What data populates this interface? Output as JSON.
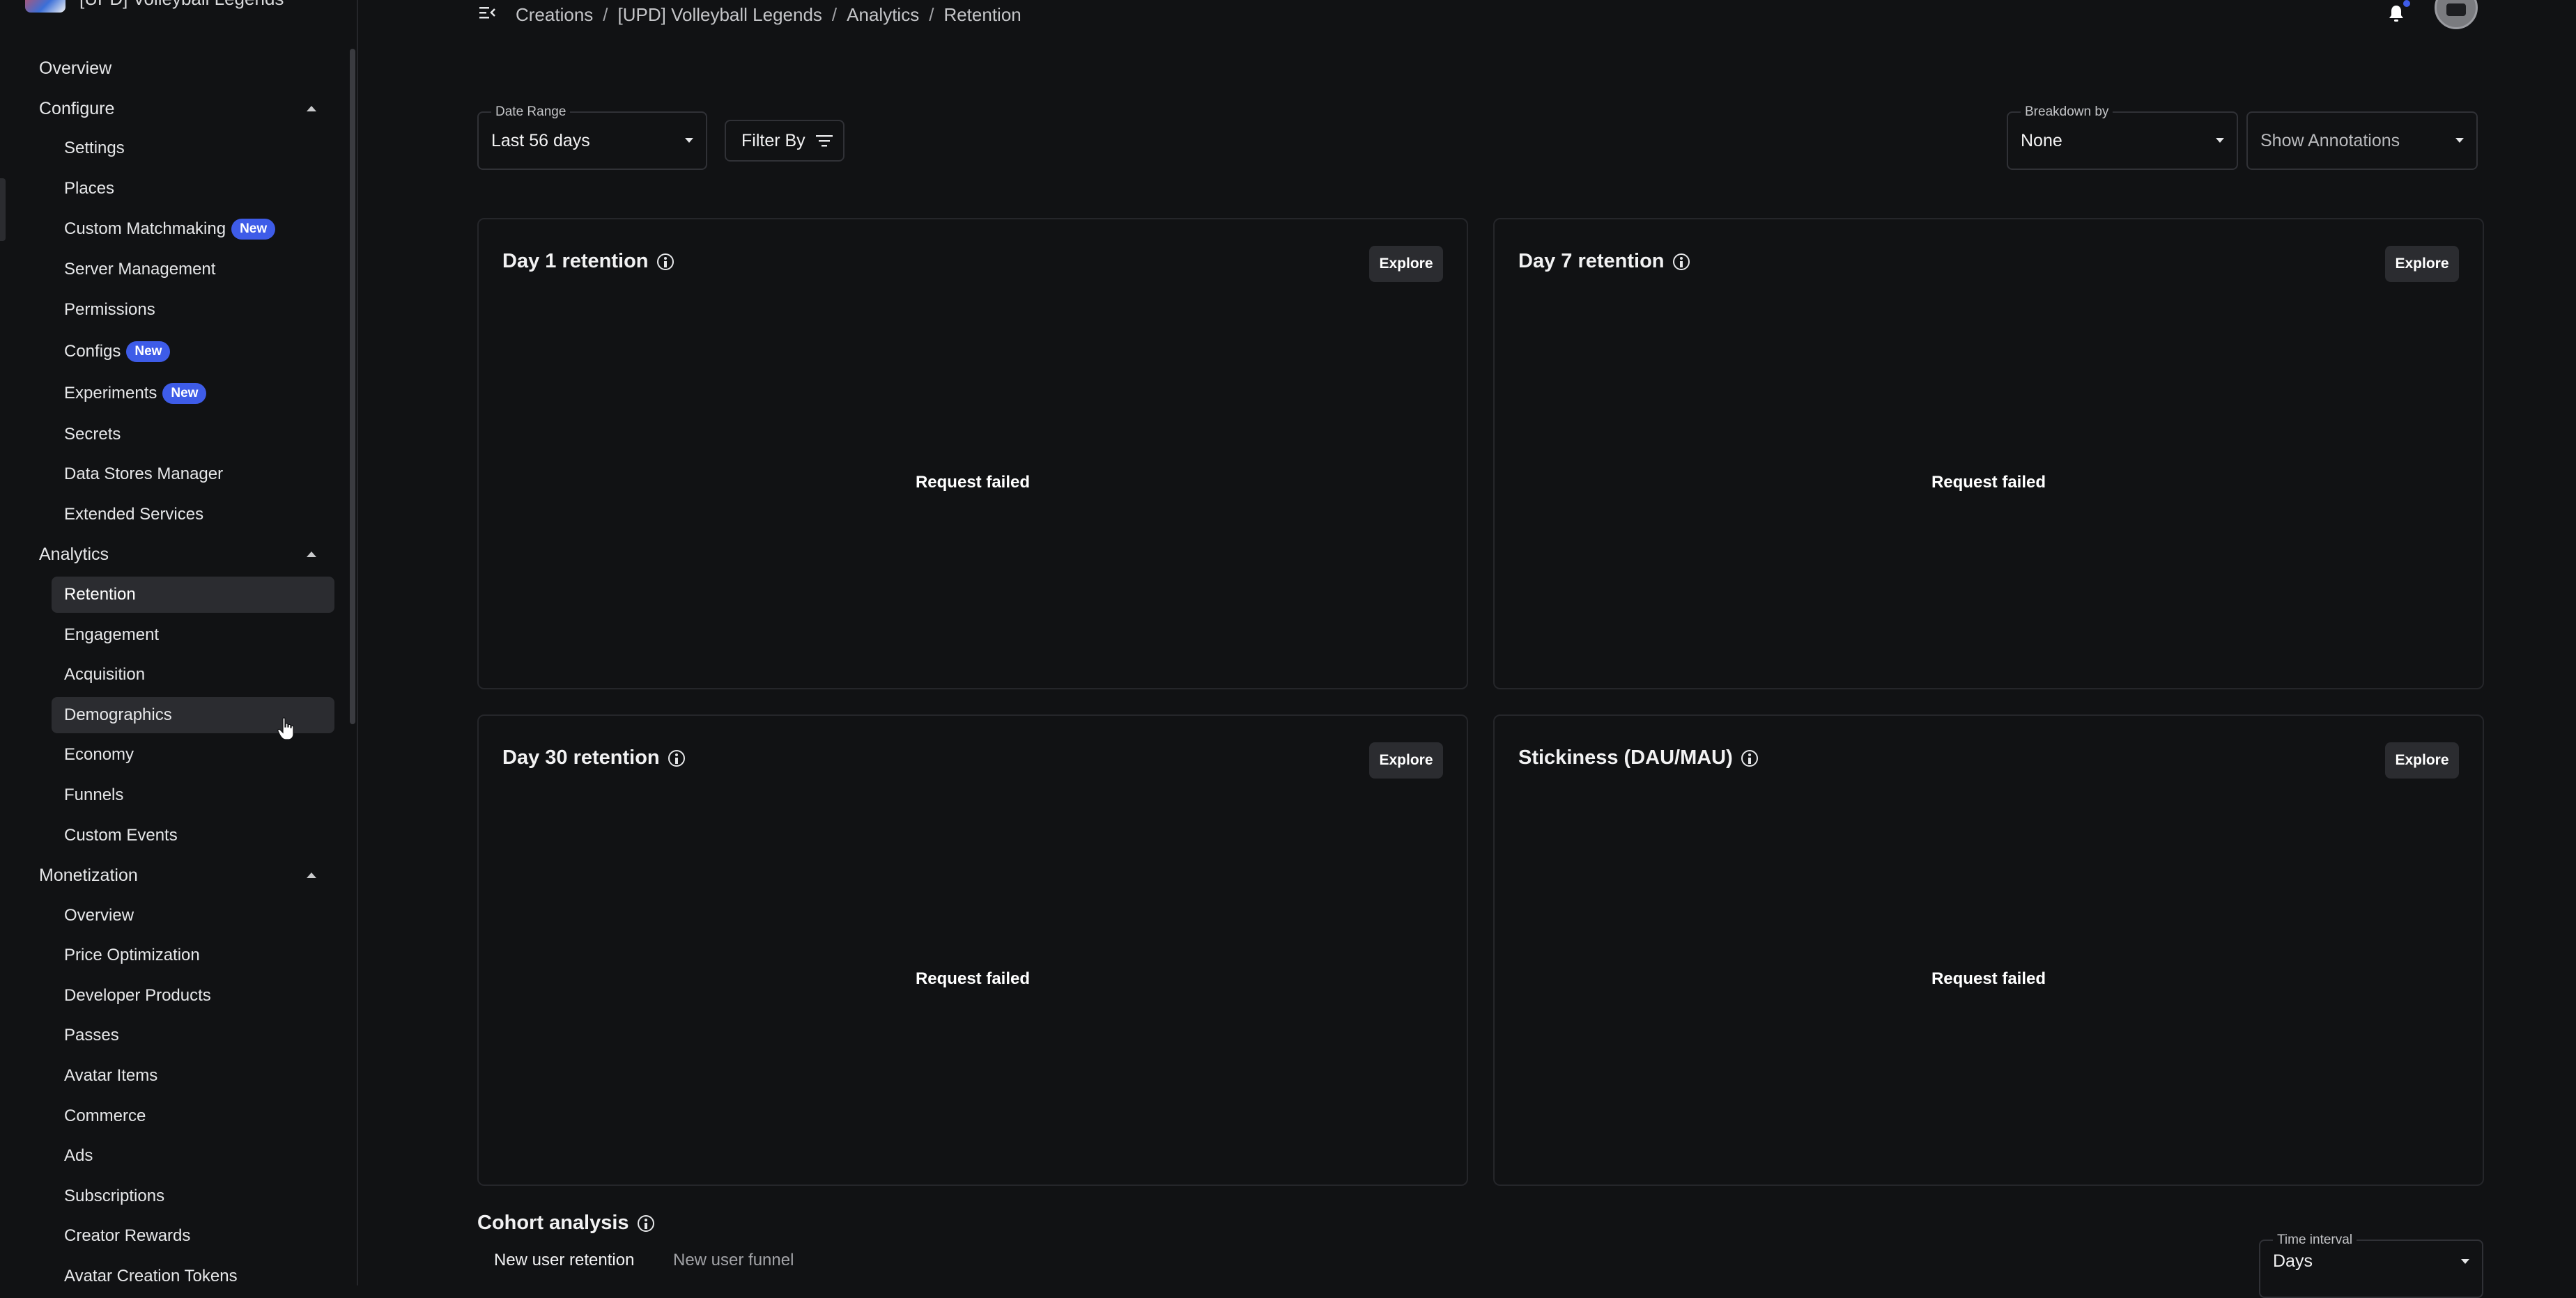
{
  "sidebar": {
    "header_text": "[UPD] Volleyball Legends",
    "top_item": "Overview",
    "sections": [
      {
        "label": "Configure",
        "items": [
          {
            "label": "Settings"
          },
          {
            "label": "Places"
          },
          {
            "label": "Custom Matchmaking",
            "badge": "New"
          },
          {
            "label": "Server Management"
          },
          {
            "label": "Permissions"
          },
          {
            "label": "Configs",
            "badge": "New"
          },
          {
            "label": "Experiments",
            "badge": "New"
          },
          {
            "label": "Secrets"
          },
          {
            "label": "Data Stores Manager"
          },
          {
            "label": "Extended Services"
          }
        ]
      },
      {
        "label": "Analytics",
        "items": [
          {
            "label": "Retention",
            "active": true
          },
          {
            "label": "Engagement"
          },
          {
            "label": "Acquisition"
          },
          {
            "label": "Demographics",
            "hover": true
          },
          {
            "label": "Economy"
          },
          {
            "label": "Funnels"
          },
          {
            "label": "Custom Events"
          }
        ]
      },
      {
        "label": "Monetization",
        "items": [
          {
            "label": "Overview"
          },
          {
            "label": "Price Optimization"
          },
          {
            "label": "Developer Products"
          },
          {
            "label": "Passes"
          },
          {
            "label": "Avatar Items"
          },
          {
            "label": "Commerce"
          },
          {
            "label": "Ads"
          },
          {
            "label": "Subscriptions"
          },
          {
            "label": "Creator Rewards"
          },
          {
            "label": "Avatar Creation Tokens"
          }
        ]
      }
    ]
  },
  "breadcrumb": [
    "Creations",
    "[UPD] Volleyball Legends",
    "Analytics",
    "Retention"
  ],
  "filters": {
    "date_range_label": "Date Range",
    "date_range_value": "Last 56 days",
    "filter_by_label": "Filter By",
    "breakdown_label": "Breakdown by",
    "breakdown_value": "None",
    "annotations_value": "Show Annotations"
  },
  "cards": [
    {
      "title": "Day 1 retention",
      "explore": "Explore",
      "status": "Request failed"
    },
    {
      "title": "Day 7 retention",
      "explore": "Explore",
      "status": "Request failed"
    },
    {
      "title": "Day 30 retention",
      "explore": "Explore",
      "status": "Request failed"
    },
    {
      "title": "Stickiness (DAU/MAU)",
      "explore": "Explore",
      "status": "Request failed"
    }
  ],
  "cohort": {
    "title": "Cohort analysis",
    "tabs": [
      "New user retention",
      "New user funnel"
    ],
    "time_interval_label": "Time interval",
    "time_interval_value": "Days"
  },
  "colors": {
    "background": "#111214",
    "accent": "#3e5ce8",
    "active_item": "#2b2c30"
  }
}
